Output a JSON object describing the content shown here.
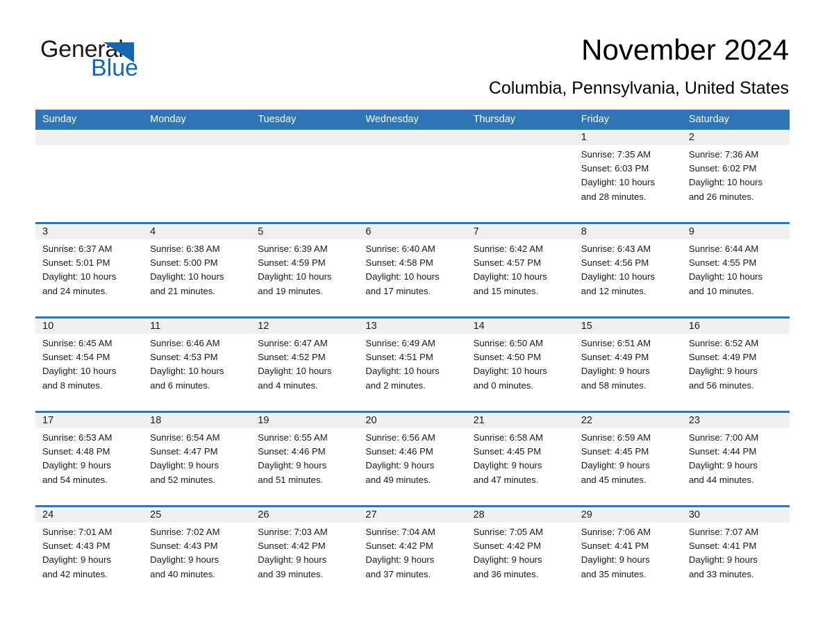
{
  "brand": {
    "name_part1": "General",
    "name_part2": "Blue",
    "triangle_color": "#1268b3",
    "accent_color": "#2f75b5"
  },
  "header": {
    "title": "November 2024",
    "subtitle": "Columbia, Pennsylvania, United States"
  },
  "calendar": {
    "weekday_headers": [
      "Sunday",
      "Monday",
      "Tuesday",
      "Wednesday",
      "Thursday",
      "Friday",
      "Saturday"
    ],
    "header_bg": "#2f75b5",
    "daynum_bg": "#f0f0f0",
    "weeks": [
      [
        {
          "day": "",
          "sunrise": "",
          "sunset": "",
          "daylight_line1": "",
          "daylight_line2": ""
        },
        {
          "day": "",
          "sunrise": "",
          "sunset": "",
          "daylight_line1": "",
          "daylight_line2": ""
        },
        {
          "day": "",
          "sunrise": "",
          "sunset": "",
          "daylight_line1": "",
          "daylight_line2": ""
        },
        {
          "day": "",
          "sunrise": "",
          "sunset": "",
          "daylight_line1": "",
          "daylight_line2": ""
        },
        {
          "day": "",
          "sunrise": "",
          "sunset": "",
          "daylight_line1": "",
          "daylight_line2": ""
        },
        {
          "day": "1",
          "sunrise": "Sunrise: 7:35 AM",
          "sunset": "Sunset: 6:03 PM",
          "daylight_line1": "Daylight: 10 hours",
          "daylight_line2": "and 28 minutes."
        },
        {
          "day": "2",
          "sunrise": "Sunrise: 7:36 AM",
          "sunset": "Sunset: 6:02 PM",
          "daylight_line1": "Daylight: 10 hours",
          "daylight_line2": "and 26 minutes."
        }
      ],
      [
        {
          "day": "3",
          "sunrise": "Sunrise: 6:37 AM",
          "sunset": "Sunset: 5:01 PM",
          "daylight_line1": "Daylight: 10 hours",
          "daylight_line2": "and 24 minutes."
        },
        {
          "day": "4",
          "sunrise": "Sunrise: 6:38 AM",
          "sunset": "Sunset: 5:00 PM",
          "daylight_line1": "Daylight: 10 hours",
          "daylight_line2": "and 21 minutes."
        },
        {
          "day": "5",
          "sunrise": "Sunrise: 6:39 AM",
          "sunset": "Sunset: 4:59 PM",
          "daylight_line1": "Daylight: 10 hours",
          "daylight_line2": "and 19 minutes."
        },
        {
          "day": "6",
          "sunrise": "Sunrise: 6:40 AM",
          "sunset": "Sunset: 4:58 PM",
          "daylight_line1": "Daylight: 10 hours",
          "daylight_line2": "and 17 minutes."
        },
        {
          "day": "7",
          "sunrise": "Sunrise: 6:42 AM",
          "sunset": "Sunset: 4:57 PM",
          "daylight_line1": "Daylight: 10 hours",
          "daylight_line2": "and 15 minutes."
        },
        {
          "day": "8",
          "sunrise": "Sunrise: 6:43 AM",
          "sunset": "Sunset: 4:56 PM",
          "daylight_line1": "Daylight: 10 hours",
          "daylight_line2": "and 12 minutes."
        },
        {
          "day": "9",
          "sunrise": "Sunrise: 6:44 AM",
          "sunset": "Sunset: 4:55 PM",
          "daylight_line1": "Daylight: 10 hours",
          "daylight_line2": "and 10 minutes."
        }
      ],
      [
        {
          "day": "10",
          "sunrise": "Sunrise: 6:45 AM",
          "sunset": "Sunset: 4:54 PM",
          "daylight_line1": "Daylight: 10 hours",
          "daylight_line2": "and 8 minutes."
        },
        {
          "day": "11",
          "sunrise": "Sunrise: 6:46 AM",
          "sunset": "Sunset: 4:53 PM",
          "daylight_line1": "Daylight: 10 hours",
          "daylight_line2": "and 6 minutes."
        },
        {
          "day": "12",
          "sunrise": "Sunrise: 6:47 AM",
          "sunset": "Sunset: 4:52 PM",
          "daylight_line1": "Daylight: 10 hours",
          "daylight_line2": "and 4 minutes."
        },
        {
          "day": "13",
          "sunrise": "Sunrise: 6:49 AM",
          "sunset": "Sunset: 4:51 PM",
          "daylight_line1": "Daylight: 10 hours",
          "daylight_line2": "and 2 minutes."
        },
        {
          "day": "14",
          "sunrise": "Sunrise: 6:50 AM",
          "sunset": "Sunset: 4:50 PM",
          "daylight_line1": "Daylight: 10 hours",
          "daylight_line2": "and 0 minutes."
        },
        {
          "day": "15",
          "sunrise": "Sunrise: 6:51 AM",
          "sunset": "Sunset: 4:49 PM",
          "daylight_line1": "Daylight: 9 hours",
          "daylight_line2": "and 58 minutes."
        },
        {
          "day": "16",
          "sunrise": "Sunrise: 6:52 AM",
          "sunset": "Sunset: 4:49 PM",
          "daylight_line1": "Daylight: 9 hours",
          "daylight_line2": "and 56 minutes."
        }
      ],
      [
        {
          "day": "17",
          "sunrise": "Sunrise: 6:53 AM",
          "sunset": "Sunset: 4:48 PM",
          "daylight_line1": "Daylight: 9 hours",
          "daylight_line2": "and 54 minutes."
        },
        {
          "day": "18",
          "sunrise": "Sunrise: 6:54 AM",
          "sunset": "Sunset: 4:47 PM",
          "daylight_line1": "Daylight: 9 hours",
          "daylight_line2": "and 52 minutes."
        },
        {
          "day": "19",
          "sunrise": "Sunrise: 6:55 AM",
          "sunset": "Sunset: 4:46 PM",
          "daylight_line1": "Daylight: 9 hours",
          "daylight_line2": "and 51 minutes."
        },
        {
          "day": "20",
          "sunrise": "Sunrise: 6:56 AM",
          "sunset": "Sunset: 4:46 PM",
          "daylight_line1": "Daylight: 9 hours",
          "daylight_line2": "and 49 minutes."
        },
        {
          "day": "21",
          "sunrise": "Sunrise: 6:58 AM",
          "sunset": "Sunset: 4:45 PM",
          "daylight_line1": "Daylight: 9 hours",
          "daylight_line2": "and 47 minutes."
        },
        {
          "day": "22",
          "sunrise": "Sunrise: 6:59 AM",
          "sunset": "Sunset: 4:45 PM",
          "daylight_line1": "Daylight: 9 hours",
          "daylight_line2": "and 45 minutes."
        },
        {
          "day": "23",
          "sunrise": "Sunrise: 7:00 AM",
          "sunset": "Sunset: 4:44 PM",
          "daylight_line1": "Daylight: 9 hours",
          "daylight_line2": "and 44 minutes."
        }
      ],
      [
        {
          "day": "24",
          "sunrise": "Sunrise: 7:01 AM",
          "sunset": "Sunset: 4:43 PM",
          "daylight_line1": "Daylight: 9 hours",
          "daylight_line2": "and 42 minutes."
        },
        {
          "day": "25",
          "sunrise": "Sunrise: 7:02 AM",
          "sunset": "Sunset: 4:43 PM",
          "daylight_line1": "Daylight: 9 hours",
          "daylight_line2": "and 40 minutes."
        },
        {
          "day": "26",
          "sunrise": "Sunrise: 7:03 AM",
          "sunset": "Sunset: 4:42 PM",
          "daylight_line1": "Daylight: 9 hours",
          "daylight_line2": "and 39 minutes."
        },
        {
          "day": "27",
          "sunrise": "Sunrise: 7:04 AM",
          "sunset": "Sunset: 4:42 PM",
          "daylight_line1": "Daylight: 9 hours",
          "daylight_line2": "and 37 minutes."
        },
        {
          "day": "28",
          "sunrise": "Sunrise: 7:05 AM",
          "sunset": "Sunset: 4:42 PM",
          "daylight_line1": "Daylight: 9 hours",
          "daylight_line2": "and 36 minutes."
        },
        {
          "day": "29",
          "sunrise": "Sunrise: 7:06 AM",
          "sunset": "Sunset: 4:41 PM",
          "daylight_line1": "Daylight: 9 hours",
          "daylight_line2": "and 35 minutes."
        },
        {
          "day": "30",
          "sunrise": "Sunrise: 7:07 AM",
          "sunset": "Sunset: 4:41 PM",
          "daylight_line1": "Daylight: 9 hours",
          "daylight_line2": "and 33 minutes."
        }
      ]
    ]
  }
}
